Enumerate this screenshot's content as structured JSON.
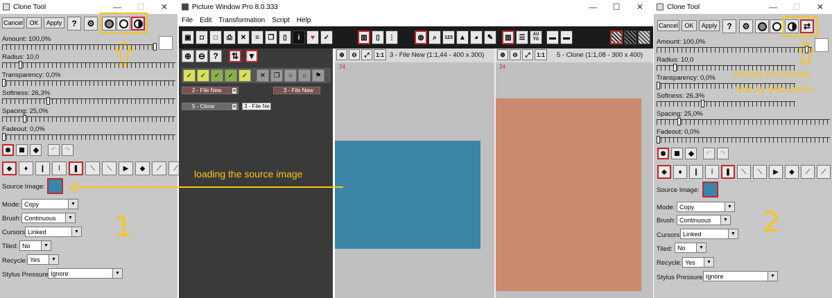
{
  "left_panel": {
    "title": "Clone Tool",
    "window_controls": [
      "—",
      "☐",
      "✕"
    ],
    "buttons": {
      "cancel": "Cancel",
      "ok": "OK",
      "apply": "Apply",
      "help": "?"
    },
    "sliders": [
      {
        "label": "Amount: 100,0%",
        "value": 100.0
      },
      {
        "label": "Radius: 10,0",
        "value": 10.0
      },
      {
        "label": "Transparency: 0,0%",
        "value": 0.0
      },
      {
        "label": "Softness: 26,3%",
        "value": 26.3
      },
      {
        "label": "Spacing: 25,0%",
        "value": 25.0
      },
      {
        "label": "Fadeout: 0,0%",
        "value": 0.0
      }
    ],
    "source_image_label": "Source Image:",
    "fields": [
      {
        "label": "Mode:",
        "value": "Copy"
      },
      {
        "label": "Brush:",
        "value": "Continuous"
      },
      {
        "label": "Cursors:",
        "value": "Linked"
      },
      {
        "label": "Tiled:",
        "value": "No"
      },
      {
        "label": "Recycle:",
        "value": "Yes"
      },
      {
        "label": "Stylus Pressure:",
        "value": "Ignore"
      }
    ],
    "step_number": "1",
    "colors": {
      "panel": "#c8c8c8",
      "source_swatch": "#3b86a8"
    }
  },
  "middle": {
    "title": "Picture Window Pro 8.0.333",
    "window_controls": [
      "—",
      "☐",
      "✕"
    ],
    "menu": [
      "File",
      "Edit",
      "Transformation",
      "Script",
      "Help"
    ],
    "tabs": [
      {
        "label": "2 - File New"
      },
      {
        "label": "3 - File New"
      },
      {
        "label": "5 - Clone"
      },
      {
        "label": "3 - File Ne"
      }
    ],
    "view_left": {
      "label": "3 - File New (1:1,44 - 400 x 300)",
      "ruler": "24",
      "one_to_one": "1:1"
    },
    "view_right": {
      "label": "5 - Clone (1:1,08 - 300 x 400)",
      "ruler": "24",
      "one_to_one": "1:1"
    },
    "toolbar_text": {
      "num": "123",
      "auto_top": "AU",
      "auto_bottom": "TO"
    },
    "annotation": "loading the source image",
    "colors": {
      "blue_rect": "#3b86a8",
      "salmon_rect": "#c98a70",
      "canvas": "#c0c0c0",
      "dark_bg": "#3a3a3a"
    }
  },
  "right_panel": {
    "title": "Clone Tool",
    "window_controls": [
      "—",
      "☐",
      "✕"
    ],
    "buttons": {
      "cancel": "Cancel",
      "ok": "OK",
      "apply": "Apply",
      "help": "?"
    },
    "sliders": [
      {
        "label": "Amount: 100,0%",
        "value": 100.0
      },
      {
        "label": "Radius: 10,0",
        "value": 10.0
      },
      {
        "label": "Transparency: 0,0%",
        "value": 0.0
      },
      {
        "label": "Softness: 26,3%",
        "value": 26.3
      },
      {
        "label": "Spacing: 25,0%",
        "value": 25.0
      },
      {
        "label": "Fadeout: 0,0%",
        "value": 0.0
      }
    ],
    "source_image_label": "Source Image:",
    "fields": [
      {
        "label": "Mode:",
        "value": "Copy"
      },
      {
        "label": "Brush:",
        "value": "Continuous"
      },
      {
        "label": "Cursors:",
        "value": "Linked"
      },
      {
        "label": "Tiled:",
        "value": "No"
      },
      {
        "label": "Recycle:",
        "value": "Yes"
      },
      {
        "label": "Stylus Pressure:",
        "value": "Ignore"
      }
    ],
    "annotation_line1": "clickinig the Display",
    "annotation_line2": "Side by Side button",
    "step_number": "2"
  }
}
